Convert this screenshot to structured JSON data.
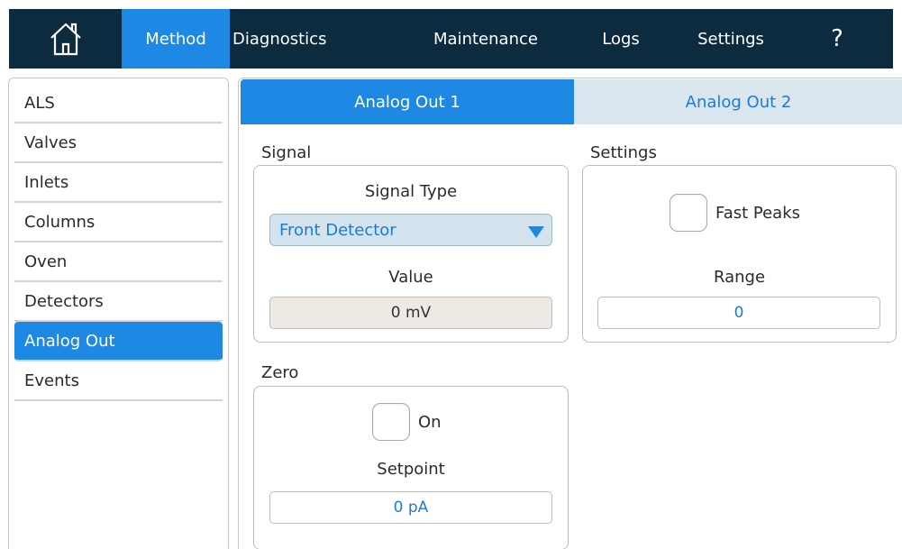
{
  "nav": {
    "home_icon": "home-icon",
    "items": [
      {
        "label": "Method",
        "active": true
      },
      {
        "label": "Diagnostics",
        "active": false
      },
      {
        "label": "Maintenance",
        "active": false
      },
      {
        "label": "Logs",
        "active": false
      },
      {
        "label": "Settings",
        "active": false
      }
    ],
    "help_label": "?"
  },
  "sidebar": {
    "items": [
      {
        "label": "ALS"
      },
      {
        "label": "Valves"
      },
      {
        "label": "Inlets"
      },
      {
        "label": "Columns"
      },
      {
        "label": "Oven"
      },
      {
        "label": "Detectors"
      },
      {
        "label": "Analog Out",
        "active": true
      },
      {
        "label": "Events"
      }
    ]
  },
  "tabs": [
    {
      "label": "Analog Out 1",
      "active": true
    },
    {
      "label": "Analog Out 2",
      "active": false
    }
  ],
  "signal": {
    "title": "Signal",
    "signal_type_label": "Signal Type",
    "signal_type_value": "Front Detector",
    "value_label": "Value",
    "value": "0 mV"
  },
  "zero": {
    "title": "Zero",
    "on_label": "On",
    "on_checked": false,
    "setpoint_label": "Setpoint",
    "setpoint_value": "0 pA"
  },
  "settings": {
    "title": "Settings",
    "fast_peaks_label": "Fast Peaks",
    "fast_peaks_checked": false,
    "range_label": "Range",
    "range_value": "0"
  },
  "colors": {
    "nav_bg": "#0c2b3f",
    "accent": "#1e88e5",
    "inactive_tab_bg": "#d9e6ee",
    "link_text": "#1f7ad6"
  }
}
